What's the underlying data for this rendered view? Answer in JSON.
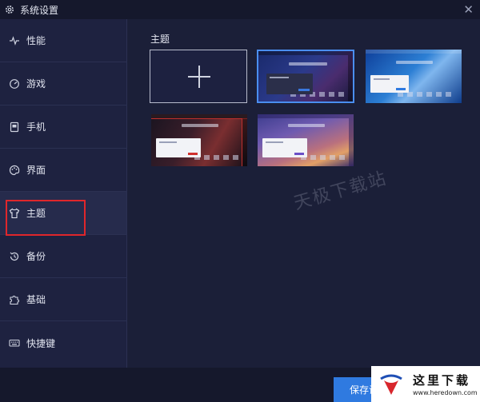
{
  "window": {
    "title": "系统设置"
  },
  "sidebar": {
    "items": [
      {
        "label": "性能",
        "icon": "pulse-icon"
      },
      {
        "label": "游戏",
        "icon": "gauge-icon"
      },
      {
        "label": "手机",
        "icon": "phone-icon"
      },
      {
        "label": "界面",
        "icon": "palette-icon"
      },
      {
        "label": "主题",
        "icon": "tshirt-icon"
      },
      {
        "label": "备份",
        "icon": "history-icon"
      },
      {
        "label": "基础",
        "icon": "puzzle-icon"
      },
      {
        "label": "快捷键",
        "icon": "keyboard-icon"
      }
    ],
    "active": "主题"
  },
  "main": {
    "section_title": "主题",
    "themes": [
      {
        "id": "add",
        "type": "add"
      },
      {
        "id": "theme-dark-blue",
        "selected": true
      },
      {
        "id": "theme-light-blue",
        "selected": false
      },
      {
        "id": "theme-dark-red",
        "selected": false
      },
      {
        "id": "theme-purple-sunset",
        "selected": false
      }
    ]
  },
  "footer": {
    "save_label": "保存设置"
  },
  "watermark": {
    "text": "天极下载站"
  },
  "logo": {
    "name": "这里下载",
    "url": "www.heredown.com"
  },
  "colors": {
    "accent": "#2f7ae0",
    "selected_border": "#4a8ef0",
    "highlight_box": "#e0262b",
    "background": "#1b1f38"
  }
}
